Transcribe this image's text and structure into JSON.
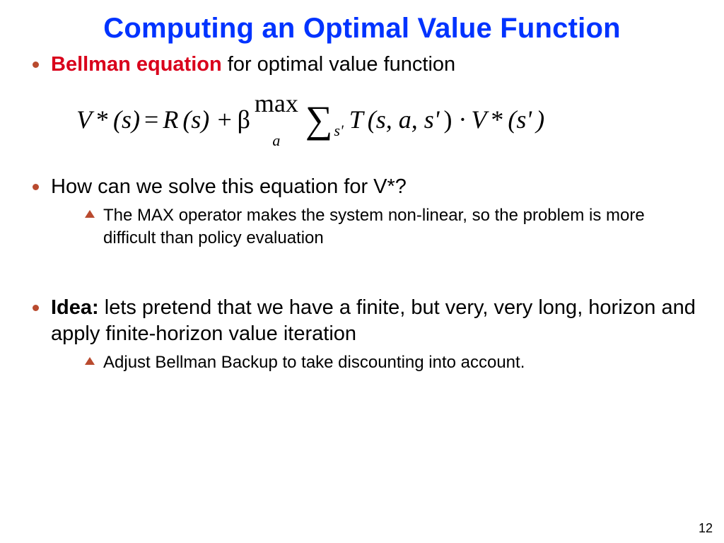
{
  "title": "Computing an Optimal Value Function",
  "bullet1": {
    "emph": "Bellman equation",
    "rest": " for optimal value function"
  },
  "equation": {
    "lhs_a": "V",
    "star1": " *",
    "lhs_b": "(s)",
    "eq": " = ",
    "r": "R",
    "r2": "(s) + ",
    "beta": "β",
    "max_word": " max",
    "max_sub": "a",
    "sigma": "∑",
    "sigma_sub": "s'",
    "t": "T",
    "t2": "(s, a, s'",
    "t3": ") · ",
    "v2": "V",
    "star2": " *",
    "v2b": "(s'",
    "v2c": ")"
  },
  "bullet2": "How can we solve this equation for V*?",
  "sub2a": "The MAX operator makes the system non-linear, so the problem is more difficult than policy evaluation",
  "bullet3": {
    "emph": "Idea:",
    "rest": " lets pretend that we have a finite, but very, very long, horizon and apply finite-horizon value iteration"
  },
  "sub3a": "Adjust Bellman Backup to take discounting into account.",
  "page_number": "12"
}
